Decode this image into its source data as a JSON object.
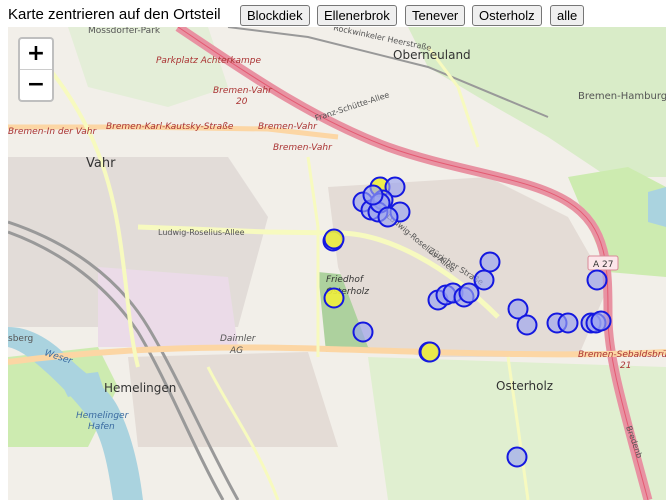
{
  "toolbar": {
    "prompt": "Karte zentrieren auf den Ortsteil",
    "buttons": [
      "Blockdiek",
      "Ellenerbrok",
      "Tenever",
      "Osterholz",
      "alle"
    ]
  },
  "zoom": {
    "in": "+",
    "out": "−"
  },
  "map_labels": {
    "oberneuland": "Oberneuland",
    "vahr": "Vahr",
    "hemelingen": "Hemelingen",
    "osterholz": "Osterholz",
    "parkplatz": "Parkplatz Achterkampe",
    "bremen_vahr_20": "Bremen-Vahr",
    "bremen_vahr_20_num": "20",
    "bremen_in_der_vahr": "Bremen-In der Vahr",
    "bremen_kk_strasse": "Bremen-Karl-Kautsky-Straße",
    "bremen_vahr_a": "Bremen-Vahr",
    "bremen_vahr_b": "Bremen-Vahr",
    "bremen_hamburg": "Bremen-Hamburg",
    "franz_schuette": "Franz-Schütte-Allee",
    "rockwinkeler": "Rockwinkeler Heerstraße",
    "ludwig_roselius": "Ludwig-Roselius-Allee",
    "ludwig_roselius_2": "Ludwig-Roselius-Allee",
    "zuericher": "Züricher Straße",
    "friedhof": "Friedhof",
    "friedhof_2": "Osterholz",
    "daimler": "Daimler",
    "daimler_ag": "AG",
    "weser": "Weser",
    "hemelinger_hafen": "Hemelinger",
    "hemelinger_hafen_2": "Hafen",
    "a27": "A 27",
    "sebaldsbr": "Bremen-Sebaldsbrü",
    "sebaldsbr_num": "21",
    "bremen_top": "Bremen-",
    "sberg": "sberg",
    "top_clip": "Mossdorfer-Park",
    "bredenbeck": "Bredenb"
  },
  "markers": {
    "blue_fill": "#9aa3f0",
    "yellow_fill": "#eeee3c",
    "stroke": "#1418e0",
    "yellow_count": 4,
    "blue_count": 39
  }
}
